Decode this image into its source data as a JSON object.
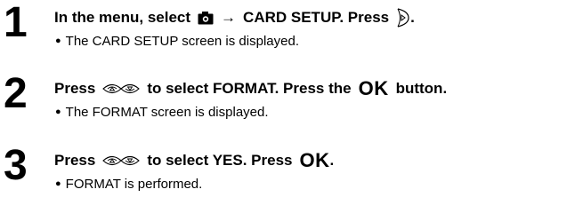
{
  "steps": [
    {
      "number": "1",
      "instruction": {
        "part1": "In the menu, select",
        "arrow": "→",
        "part2": "CARD SETUP. Press",
        "end": "."
      },
      "detail": "The CARD SETUP screen is displayed.",
      "icons": [
        "camera-mode-icon",
        "right-arrow-icon",
        "dial-right-button-icon"
      ]
    },
    {
      "number": "2",
      "instruction": {
        "part1": "Press",
        "part2": "to select FORMAT. Press the",
        "ok": "OK",
        "end": "button."
      },
      "detail": "The FORMAT screen is displayed.",
      "icons": [
        "up-down-dial-icon"
      ]
    },
    {
      "number": "3",
      "instruction": {
        "part1": "Press",
        "part2": "to select YES. Press",
        "ok": "OK",
        "end": "."
      },
      "detail": "FORMAT is performed.",
      "icons": [
        "up-down-dial-icon"
      ]
    }
  ],
  "bullet": "●"
}
